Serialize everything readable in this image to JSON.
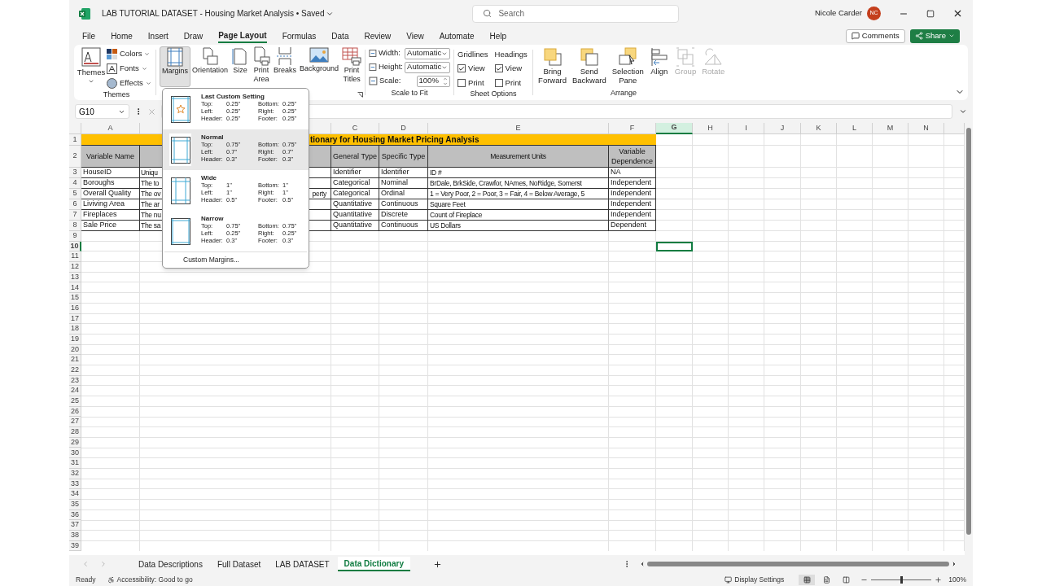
{
  "title_bar": {
    "file_name": "LAB TUTORIAL DATASET - Housing Market Analysis",
    "separator": "•",
    "save_state": "Saved",
    "search_placeholder": "Search",
    "user_name": "Nicole Carder",
    "user_initials": "NC"
  },
  "menu_tabs": [
    {
      "label": "File",
      "selected": false
    },
    {
      "label": "Home",
      "selected": false
    },
    {
      "label": "Insert",
      "selected": false
    },
    {
      "label": "Draw",
      "selected": false
    },
    {
      "label": "Page Layout",
      "selected": true
    },
    {
      "label": "Formulas",
      "selected": false
    },
    {
      "label": "Data",
      "selected": false
    },
    {
      "label": "Review",
      "selected": false
    },
    {
      "label": "View",
      "selected": false
    },
    {
      "label": "Automate",
      "selected": false
    },
    {
      "label": "Help",
      "selected": false
    }
  ],
  "actions": {
    "comments": "Comments",
    "share": "Share"
  },
  "ribbon": {
    "themes": {
      "label": "Themes",
      "big": "Themes",
      "items": [
        {
          "kind": "colors",
          "label": "Colors"
        },
        {
          "kind": "fonts",
          "label": "Fonts"
        },
        {
          "kind": "effects",
          "label": "Effects"
        }
      ]
    },
    "page_setup": [
      {
        "kind": "margins",
        "lines": [
          "Margins"
        ],
        "selected": true
      },
      {
        "kind": "orientation",
        "lines": [
          "Orientation"
        ],
        "selected": false
      },
      {
        "kind": "size",
        "lines": [
          "Size"
        ],
        "selected": false
      },
      {
        "kind": "print_area",
        "lines": [
          "Print",
          "Area"
        ],
        "selected": false
      },
      {
        "kind": "breaks",
        "lines": [
          "Breaks"
        ],
        "selected": false
      },
      {
        "kind": "background",
        "lines": [
          "Background"
        ],
        "selected": false
      },
      {
        "kind": "print_titles",
        "lines": [
          "Print",
          "Titles"
        ],
        "selected": false
      }
    ],
    "scale_to_fit": {
      "label": "Scale to Fit",
      "fields": [
        {
          "kind": "width",
          "label": "Width:",
          "value": "Automatic"
        },
        {
          "kind": "height",
          "label": "Height:",
          "value": "Automatic"
        },
        {
          "kind": "scale",
          "label": "Scale:",
          "value": "100%"
        }
      ]
    },
    "sheet_options": {
      "label": "Sheet Options",
      "columns": [
        {
          "title": "Gridlines",
          "options": [
            {
              "label": "View",
              "checked": true
            },
            {
              "label": "Print",
              "checked": false
            }
          ]
        },
        {
          "title": "Headings",
          "options": [
            {
              "label": "View",
              "checked": true
            },
            {
              "label": "Print",
              "checked": false
            }
          ]
        }
      ]
    },
    "arrange": {
      "label": "Arrange",
      "buttons": [
        {
          "kind": "bring_forward",
          "lines": [
            "Bring",
            "Forward"
          ],
          "disabled": false
        },
        {
          "kind": "send_backward",
          "lines": [
            "Send",
            "Backward"
          ],
          "disabled": false
        },
        {
          "kind": "selection_pane",
          "lines": [
            "Selection",
            "Pane"
          ],
          "disabled": false
        },
        {
          "kind": "align",
          "lines": [
            "Align"
          ],
          "disabled": false
        },
        {
          "kind": "group",
          "lines": [
            "Group"
          ],
          "disabled": true
        },
        {
          "kind": "rotate",
          "lines": [
            "Rotate"
          ],
          "disabled": true
        }
      ]
    }
  },
  "formula_bar": {
    "name_box": "G10"
  },
  "margins_menu": {
    "presets": [
      {
        "kind": "custom",
        "name": "Last Custom Setting",
        "selected": false,
        "values": [
          {
            "label": "Top:",
            "value": "0.25\""
          },
          {
            "label": "Bottom:",
            "value": "0.25\""
          },
          {
            "label": "Left:",
            "value": "0.25\""
          },
          {
            "label": "Right:",
            "value": "0.25\""
          },
          {
            "label": "Header:",
            "value": "0.25\""
          },
          {
            "label": "Footer:",
            "value": "0.25\""
          }
        ]
      },
      {
        "kind": "normal",
        "name": "Normal",
        "selected": true,
        "values": [
          {
            "label": "Top:",
            "value": "0.75\""
          },
          {
            "label": "Bottom:",
            "value": "0.75\""
          },
          {
            "label": "Left:",
            "value": "0.7\""
          },
          {
            "label": "Right:",
            "value": "0.7\""
          },
          {
            "label": "Header:",
            "value": "0.3\""
          },
          {
            "label": "Footer:",
            "value": "0.3\""
          }
        ]
      },
      {
        "kind": "wide",
        "name": "Wide",
        "selected": false,
        "values": [
          {
            "label": "Top:",
            "value": "1\""
          },
          {
            "label": "Bottom:",
            "value": "1\""
          },
          {
            "label": "Left:",
            "value": "1\""
          },
          {
            "label": "Right:",
            "value": "1\""
          },
          {
            "label": "Header:",
            "value": "0.5\""
          },
          {
            "label": "Footer:",
            "value": "0.5\""
          }
        ]
      },
      {
        "kind": "narrow",
        "name": "Narrow",
        "selected": false,
        "values": [
          {
            "label": "Top:",
            "value": "0.75\""
          },
          {
            "label": "Bottom:",
            "value": "0.75\""
          },
          {
            "label": "Left:",
            "value": "0.25\""
          },
          {
            "label": "Right:",
            "value": "0.25\""
          },
          {
            "label": "Header:",
            "value": "0.3\""
          },
          {
            "label": "Footer:",
            "value": "0.3\""
          }
        ]
      }
    ],
    "custom": "Custom Margins..."
  },
  "grid": {
    "columns": [
      {
        "letter": "A",
        "selected": false
      },
      {},
      {
        "letter": "C",
        "selected": false
      },
      {
        "letter": "D",
        "selected": false
      },
      {
        "letter": "E",
        "selected": false
      },
      {
        "letter": "F",
        "selected": false
      },
      {
        "letter": "G",
        "selected": true
      },
      {
        "letter": "H",
        "selected": false
      },
      {
        "letter": "I",
        "selected": false
      },
      {
        "letter": "J",
        "selected": false
      },
      {
        "letter": "K",
        "selected": false
      },
      {
        "letter": "L",
        "selected": false
      },
      {
        "letter": "M",
        "selected": false
      },
      {
        "letter": "N",
        "selected": false
      }
    ],
    "row_numbers": [
      {
        "label": "1",
        "selected": false
      },
      {
        "label": "2",
        "selected": false
      },
      {
        "label": "3",
        "selected": false
      },
      {
        "label": "4",
        "selected": false
      },
      {
        "label": "5",
        "selected": false
      },
      {
        "label": "6",
        "selected": false
      },
      {
        "label": "7",
        "selected": false
      },
      {
        "label": "8",
        "selected": false
      },
      {
        "label": "9",
        "selected": false
      },
      {
        "label": "10",
        "selected": true
      },
      {
        "label": "11",
        "selected": false
      },
      {
        "label": "12",
        "selected": false
      },
      {
        "label": "13",
        "selected": false
      },
      {
        "label": "14",
        "selected": false
      },
      {
        "label": "15",
        "selected": false
      },
      {
        "label": "16",
        "selected": false
      },
      {
        "label": "17",
        "selected": false
      },
      {
        "label": "18",
        "selected": false
      },
      {
        "label": "19",
        "selected": false
      },
      {
        "label": "20",
        "selected": false
      },
      {
        "label": "21",
        "selected": false
      },
      {
        "label": "22",
        "selected": false
      },
      {
        "label": "23",
        "selected": false
      },
      {
        "label": "24",
        "selected": false
      },
      {
        "label": "25",
        "selected": false
      },
      {
        "label": "26",
        "selected": false
      },
      {
        "label": "27",
        "selected": false
      },
      {
        "label": "28",
        "selected": false
      },
      {
        "label": "29",
        "selected": false
      },
      {
        "label": "30",
        "selected": false
      },
      {
        "label": "31",
        "selected": false
      },
      {
        "label": "32",
        "selected": false
      },
      {
        "label": "33",
        "selected": false
      },
      {
        "label": "34",
        "selected": false
      },
      {
        "label": "35",
        "selected": false
      },
      {
        "label": "36",
        "selected": false
      },
      {
        "label": "37",
        "selected": false
      },
      {
        "label": "38",
        "selected": false
      },
      {
        "label": "39",
        "selected": false
      }
    ]
  },
  "table": {
    "title": "tionary for Housing Market Pricing Analysis",
    "header": [
      {
        "text": "Variable Name"
      },
      {
        "kind": "covered"
      },
      {
        "text": "General Type"
      },
      {
        "text": "Specific Type"
      },
      {
        "text": "Measurement Units"
      },
      {
        "text": "Variable Dependence"
      }
    ],
    "rows": [
      [
        {
          "text": "HouseID"
        },
        {
          "text": "Uniqu"
        },
        {
          "text": "Identifier"
        },
        {
          "text": "Identifier"
        },
        {
          "text": "ID #"
        },
        {
          "text": "NA"
        }
      ],
      [
        {
          "text": "Boroughs"
        },
        {
          "text": "The to"
        },
        {
          "text": "Categorical"
        },
        {
          "text": "Nominal"
        },
        {
          "text": "BrDale, BrkSide, Crawfor, NAmes, NoRidge, Somerst"
        },
        {
          "text": "Independent"
        }
      ],
      [
        {
          "text": "Overall Quality"
        },
        {
          "text": "The ov",
          "tail": "perty"
        },
        {
          "text": "Categorical"
        },
        {
          "text": "Ordinal"
        },
        {
          "text": "1 = Very Poor, 2 = Poor, 3 = Fair, 4 = Below Average, 5"
        },
        {
          "text": "Independent"
        }
      ],
      [
        {
          "text": "Liviving Area"
        },
        {
          "text": "The ar"
        },
        {
          "text": "Quantitative"
        },
        {
          "text": "Continuous"
        },
        {
          "text": "Square Feet"
        },
        {
          "text": "Independent"
        }
      ],
      [
        {
          "text": "Fireplaces"
        },
        {
          "text": "The nu"
        },
        {
          "text": "Quantitative"
        },
        {
          "text": "Discrete"
        },
        {
          "text": "Count of Fireplace"
        },
        {
          "text": "Independent"
        }
      ],
      [
        {
          "text": "Sale Price"
        },
        {
          "text": "The sa"
        },
        {
          "text": "Quantitative"
        },
        {
          "text": "Continuous"
        },
        {
          "text": "US Dollars"
        },
        {
          "text": "Dependent"
        }
      ]
    ]
  },
  "sheet_tabs": [
    {
      "label": "Data Descriptions",
      "selected": false
    },
    {
      "label": "Full Dataset",
      "selected": false
    },
    {
      "label": "LAB DATASET",
      "selected": false
    },
    {
      "label": "Data Dictionary",
      "selected": true
    }
  ],
  "status_bar": {
    "ready": "Ready",
    "accessibility": "Accessibility: Good to go",
    "display_settings": "Display Settings",
    "views": [
      {
        "kind": "normal",
        "selected": true
      },
      {
        "kind": "page_layout",
        "selected": false
      },
      {
        "kind": "page_break",
        "selected": false
      }
    ],
    "zoom": "100%",
    "level": 0.5
  }
}
